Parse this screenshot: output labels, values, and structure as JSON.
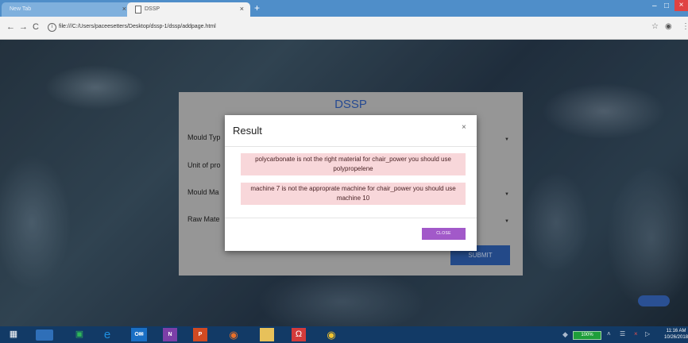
{
  "browser": {
    "tabs": [
      {
        "title": "New Tab",
        "close": "×"
      },
      {
        "title": "DSSP",
        "close": "×"
      }
    ],
    "new_tab": "+",
    "window": {
      "minimize": "–",
      "maximize": "□",
      "close": "×"
    },
    "nav": {
      "back": "←",
      "forward": "→",
      "reload": "C"
    },
    "url": "file:///C:/Users/paceesetters/Desktop/dssp-1/dssp/addpage.html",
    "star": "☆"
  },
  "form": {
    "title": "DSSP",
    "fields": [
      "Mould Typ",
      "Unit of pro",
      "Mould Ma",
      "Raw Mate"
    ],
    "submit": "SUBMIT"
  },
  "modal": {
    "title": "Result",
    "close": "×",
    "messages": [
      "polycarbonate is not the right material for chair_power you should use polypropelene",
      "machine 7 is not the approprate machine for chair_power you should use machine 10"
    ],
    "button": "CLOSE"
  },
  "taskbar": {
    "battery": "100%",
    "time": "11:16 AM",
    "date": "10/26/2018"
  }
}
